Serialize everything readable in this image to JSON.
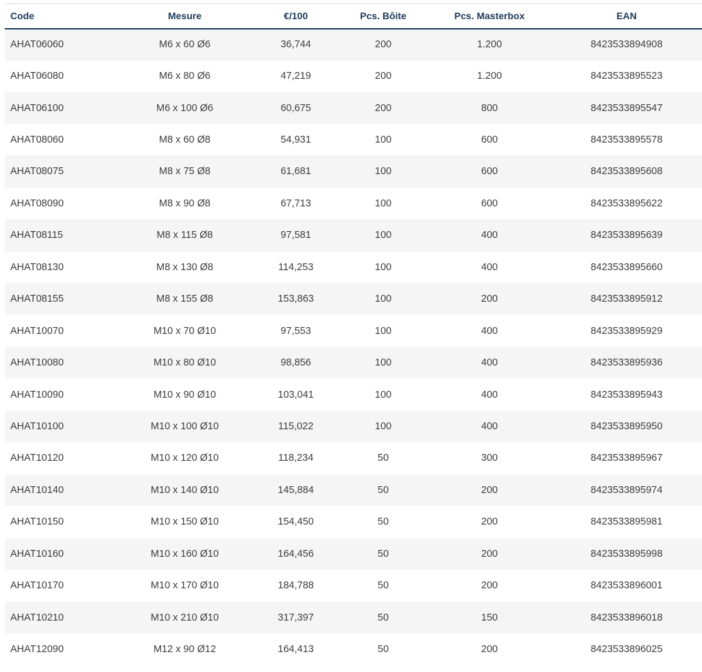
{
  "table": {
    "columns": [
      "Code",
      "Mesure",
      "€/100",
      "Pcs. Bôite",
      "Pcs. Masterbox",
      "EAN"
    ],
    "rows": [
      [
        "AHAT06060",
        "M6 x 60 Ø6",
        "36,744",
        "200",
        "1.200",
        "8423533894908"
      ],
      [
        "AHAT06080",
        "M6 x 80 Ø6",
        "47,219",
        "200",
        "1.200",
        "8423533895523"
      ],
      [
        "AHAT06100",
        "M6 x 100 Ø6",
        "60,675",
        "200",
        "800",
        "8423533895547"
      ],
      [
        "AHAT08060",
        "M8 x 60 Ø8",
        "54,931",
        "100",
        "600",
        "8423533895578"
      ],
      [
        "AHAT08075",
        "M8 x 75 Ø8",
        "61,681",
        "100",
        "600",
        "8423533895608"
      ],
      [
        "AHAT08090",
        "M8 x 90 Ø8",
        "67,713",
        "100",
        "600",
        "8423533895622"
      ],
      [
        "AHAT08115",
        "M8 x 115 Ø8",
        "97,581",
        "100",
        "400",
        "8423533895639"
      ],
      [
        "AHAT08130",
        "M8 x 130 Ø8",
        "114,253",
        "100",
        "400",
        "8423533895660"
      ],
      [
        "AHAT08155",
        "M8 x 155 Ø8",
        "153,863",
        "100",
        "200",
        "8423533895912"
      ],
      [
        "AHAT10070",
        "M10 x 70 Ø10",
        "97,553",
        "100",
        "400",
        "8423533895929"
      ],
      [
        "AHAT10080",
        "M10 x 80 Ø10",
        "98,856",
        "100",
        "400",
        "8423533895936"
      ],
      [
        "AHAT10090",
        "M10 x 90 Ø10",
        "103,041",
        "100",
        "400",
        "8423533895943"
      ],
      [
        "AHAT10100",
        "M10 x 100 Ø10",
        "115,022",
        "100",
        "400",
        "8423533895950"
      ],
      [
        "AHAT10120",
        "M10 x 120 Ø10",
        "118,234",
        "50",
        "300",
        "8423533895967"
      ],
      [
        "AHAT10140",
        "M10 x 140 Ø10",
        "145,884",
        "50",
        "200",
        "8423533895974"
      ],
      [
        "AHAT10150",
        "M10 x 150 Ø10",
        "154,450",
        "50",
        "200",
        "8423533895981"
      ],
      [
        "AHAT10160",
        "M10 x 160 Ø10",
        "164,456",
        "50",
        "200",
        "8423533895998"
      ],
      [
        "AHAT10170",
        "M10 x 170 Ø10",
        "184,788",
        "50",
        "200",
        "8423533896001"
      ],
      [
        "AHAT10210",
        "M10 x 210 Ø10",
        "317,397",
        "50",
        "150",
        "8423533896018"
      ],
      [
        "AHAT12090",
        "M12 x 90 Ø12",
        "164,413",
        "50",
        "200",
        "8423533896025"
      ]
    ]
  },
  "colors": {
    "header_text": "#1d3a5c",
    "header_rule": "#1d3a5c",
    "row_stripe": "#f5f5f5",
    "cell_text": "#3d3d3d"
  }
}
